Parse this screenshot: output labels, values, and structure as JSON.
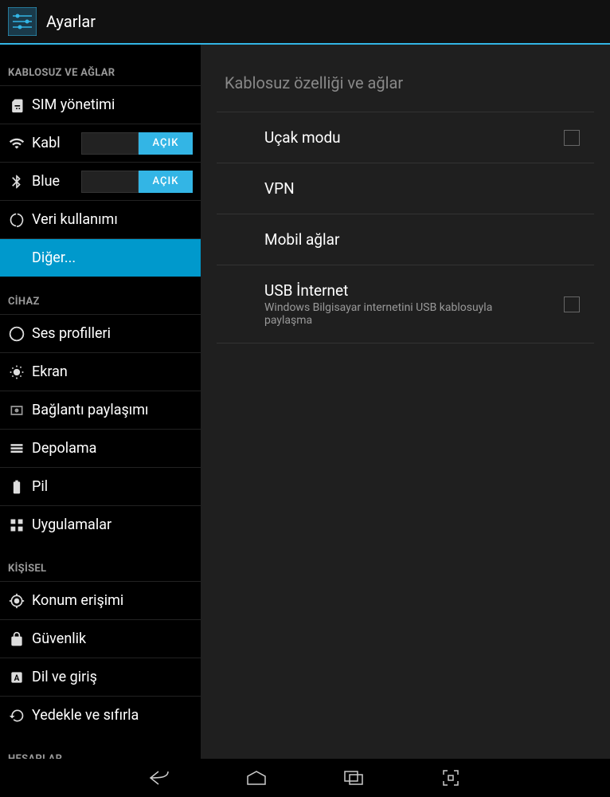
{
  "app": {
    "title": "Ayarlar"
  },
  "sidebar": {
    "sections": [
      {
        "header": "KABLOSUZ VE AĞLAR",
        "items": [
          {
            "icon": "sim-icon",
            "label": "SIM yönetimi"
          },
          {
            "icon": "wifi-icon",
            "label": "Kabl",
            "switch": "AÇIK"
          },
          {
            "icon": "bluetooth-icon",
            "label": "Blue",
            "switch": "AÇIK"
          },
          {
            "icon": "data-usage-icon",
            "label": "Veri kullanımı"
          },
          {
            "icon": null,
            "label": "Diğer...",
            "selected": true
          }
        ]
      },
      {
        "header": "CİHAZ",
        "items": [
          {
            "icon": "audio-icon",
            "label": "Ses profilleri"
          },
          {
            "icon": "display-icon",
            "label": "Ekran"
          },
          {
            "icon": "tether-icon",
            "label": "Bağlantı paylaşımı"
          },
          {
            "icon": "storage-icon",
            "label": "Depolama"
          },
          {
            "icon": "battery-icon",
            "label": "Pil"
          },
          {
            "icon": "apps-icon",
            "label": "Uygulamalar"
          }
        ]
      },
      {
        "header": "KİŞİSEL",
        "items": [
          {
            "icon": "location-icon",
            "label": "Konum erişimi"
          },
          {
            "icon": "security-icon",
            "label": "Güvenlik"
          },
          {
            "icon": "language-icon",
            "label": "Dil ve giriş"
          },
          {
            "icon": "backup-icon",
            "label": "Yedekle ve sıfırla"
          }
        ]
      },
      {
        "header": "HESAPLAR",
        "items": []
      }
    ]
  },
  "main": {
    "header": "Kablosuz özelliği ve ağlar",
    "items": [
      {
        "title": "Uçak modu",
        "checkbox": true
      },
      {
        "title": "VPN"
      },
      {
        "title": "Mobil ağlar"
      },
      {
        "title": "USB İnternet",
        "subtitle": "Windows Bilgisayar internetini USB kablosuyla paylaşma",
        "checkbox": true
      }
    ]
  }
}
